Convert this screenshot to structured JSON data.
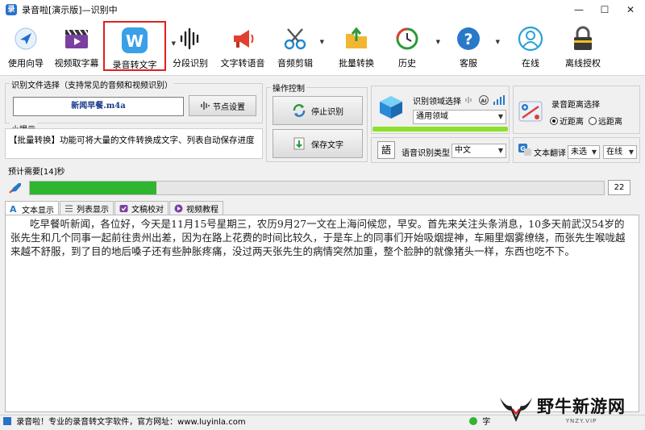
{
  "window": {
    "title": "录音啦[演示版]—识别中",
    "app_icon": "录"
  },
  "toolbar": {
    "items": [
      {
        "label": "使用向导",
        "icon": "navigation-arrow-icon"
      },
      {
        "label": "视频取字幕",
        "icon": "film-clapper-icon"
      },
      {
        "label": "录音转文字",
        "icon": "w-app-icon"
      },
      {
        "label": "分段识别",
        "icon": "sound-wave-icon"
      },
      {
        "label": "文字转语音",
        "icon": "megaphone-icon"
      },
      {
        "label": "音频剪辑",
        "icon": "scissors-icon"
      },
      {
        "label": "批量转换",
        "icon": "folder-arrow-icon"
      },
      {
        "label": "历史",
        "icon": "history-clock-icon"
      },
      {
        "label": "客服",
        "icon": "help-question-icon"
      },
      {
        "label": "在线",
        "icon": "user-online-icon"
      },
      {
        "label": "离线授权",
        "icon": "padlock-icon"
      }
    ]
  },
  "file_group": {
    "label": "识别文件选择（支持常见的音频和视频识别）",
    "filename": "新闻早餐.m4a",
    "node_button": "节点设置"
  },
  "tip_group": {
    "label": "小提示",
    "text": "【批量转换】功能可将大量的文件转换成文字、列表自动保存进度"
  },
  "ops_group": {
    "label": "操作控制",
    "stop_button": "停止识别",
    "save_button": "保存文字"
  },
  "domain_select": {
    "label": "识别领域选择",
    "value": "通用领域"
  },
  "distance": {
    "label": "录音距离选择",
    "near": "近距离",
    "far": "远距离",
    "selected": "near"
  },
  "speech_type": {
    "label": "语音识别类型",
    "value": "中文",
    "badge": "語"
  },
  "translate": {
    "label": "文本翻译",
    "option1": "未选",
    "option2": "在线"
  },
  "progress": {
    "label": "预计需要[14]秒",
    "value": 22,
    "display": "22"
  },
  "tabs": [
    {
      "label": "文本显示",
      "active": true
    },
    {
      "label": "列表显示",
      "active": false
    },
    {
      "label": "文稿校对",
      "active": false
    },
    {
      "label": "视频教程",
      "active": false
    }
  ],
  "transcript": "吃早餐听新闻，各位好，今天是11月15号星期三，农历9月27一文在上海问候您，早安。首先来关注头条消息，10多天前武汉54岁的张先生和几个同事一起前往贵州出差，因为在路上花费的时间比较久，于是车上的同事们开始吸烟提神，车厢里烟雾缭绕，而张先生喉咙越来越不舒服，到了目的地后嗓子还有些肿胀疼痛，没过两天张先生的病情突然加重，整个脸肿的就像猪头一样，东西也吃不下。",
  "status": {
    "text": "录音啦！专业的录音转文字软件，官方网址：www.luyinla.com",
    "right": "字"
  },
  "watermark": {
    "text": "野牛新游网",
    "sub": "YNZY.VIP"
  },
  "colors": {
    "accent_red": "#e02020",
    "progress_green": "#2fb52f"
  }
}
